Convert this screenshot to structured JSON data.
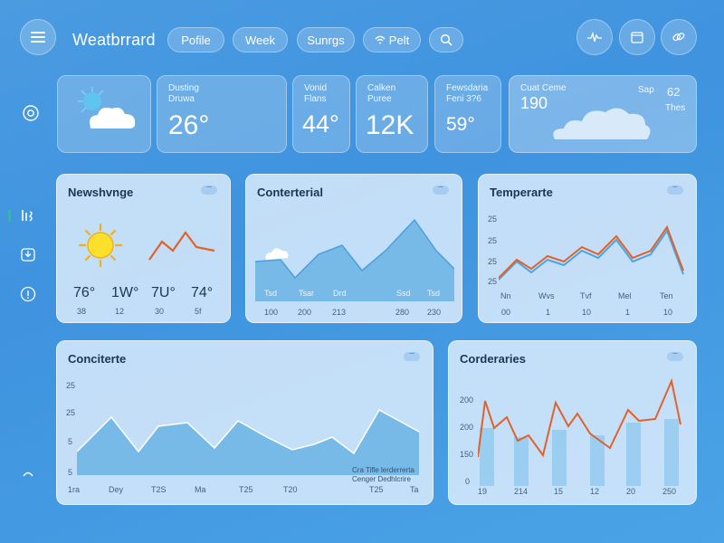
{
  "app": {
    "title": "Weatbrrard"
  },
  "nav": {
    "tabs": [
      {
        "label": "Pofile"
      },
      {
        "label": "Week"
      },
      {
        "label": "Sunrgs"
      },
      {
        "label": "Pelt"
      }
    ]
  },
  "stats": [
    {
      "label": "Dusting\nDruwa",
      "value": "26°"
    },
    {
      "label": "Vonid\nFlans",
      "value": "44°"
    },
    {
      "label": "Calken\nPuree",
      "value": "12K"
    },
    {
      "label": "Fewsdaria\nFeni 3?6",
      "value": "59°"
    },
    {
      "label": "Cuat Ceme",
      "value": "190",
      "tag": "Sap",
      "side_value": "62",
      "side_label": "Thes"
    }
  ],
  "panels": {
    "forecast": {
      "title": "Newshvnge",
      "menu": "ˇˇ",
      "temps": [
        "76°",
        "1W°",
        "7U°",
        "74°"
      ],
      "subs": [
        "38",
        "12",
        "30",
        "5f"
      ]
    },
    "area": {
      "title": "Conterterial",
      "menu": "ˇˇ",
      "inner": [
        "Tsd",
        "Tsar",
        "Drd",
        "Ssd",
        "Tsd"
      ],
      "x": [
        "100",
        "200",
        "213",
        "280",
        "230"
      ]
    },
    "temperature": {
      "title": "Temperarte",
      "menu": "ˇˇ",
      "y": [
        "25",
        "25",
        "25",
        "25"
      ],
      "x_days": [
        "Nn",
        "Wvs",
        "Tvf",
        "Mel",
        "Ten"
      ],
      "x_vals": [
        "00",
        "1",
        "10",
        "1",
        "10"
      ]
    },
    "large": {
      "title": "Conciterte",
      "menu": "ˇˇ",
      "y": [
        "25",
        "25",
        "5",
        "5"
      ],
      "x": [
        "1ra",
        "Dey",
        "T2S",
        "Ma",
        "T25",
        "T20",
        "T25",
        "Ta"
      ],
      "note": "Cra  Tifle  lerderrerta\nCenger  Dedhlcrire"
    },
    "bars": {
      "title": "Corderaries",
      "menu": "ˇˇ",
      "y": [
        "200",
        "200",
        "150",
        "0"
      ],
      "x": [
        "19",
        "214",
        "15",
        "12",
        "20",
        "250"
      ]
    }
  },
  "colors": {
    "accent_orange": "#e0622a",
    "accent_blue": "#4aa6e0",
    "indicator_green": "#2ec27e"
  }
}
